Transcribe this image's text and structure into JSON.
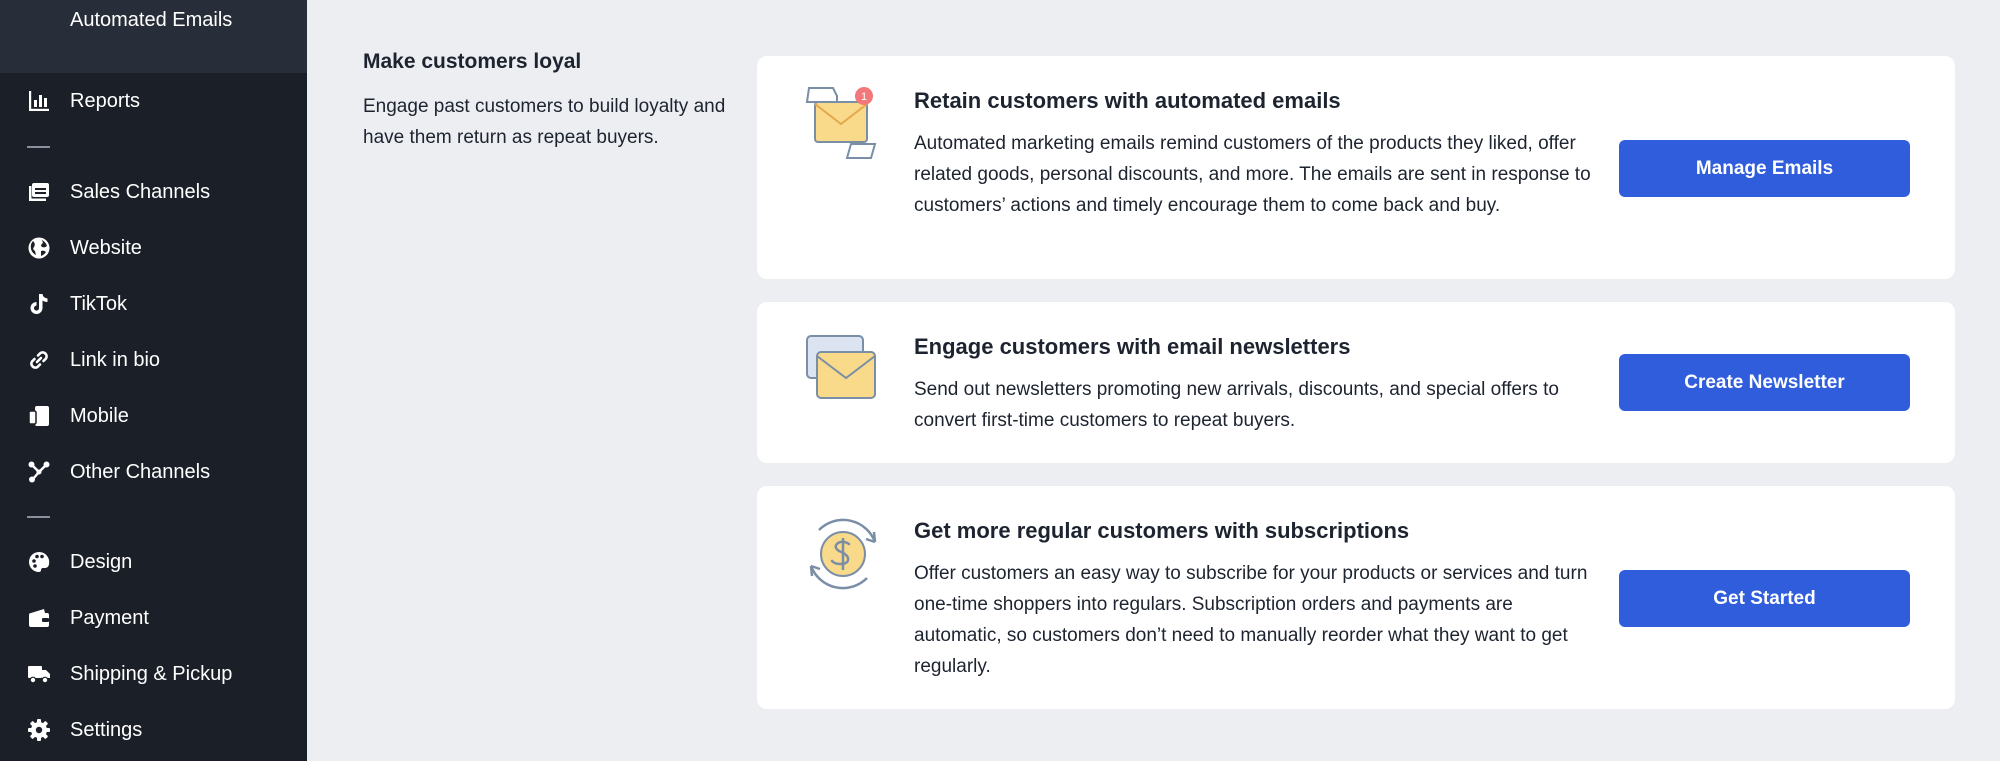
{
  "sidebar": {
    "sub_item": "Automated Emails",
    "items": [
      {
        "label": "Reports",
        "icon": "bar-chart-icon"
      },
      {
        "label": "Sales Channels",
        "icon": "sales-channels-icon"
      },
      {
        "label": "Website",
        "icon": "globe-icon"
      },
      {
        "label": "TikTok",
        "icon": "tiktok-icon"
      },
      {
        "label": "Link in bio",
        "icon": "link-icon"
      },
      {
        "label": "Mobile",
        "icon": "mobile-icon"
      },
      {
        "label": "Other Channels",
        "icon": "share-nodes-icon"
      },
      {
        "label": "Design",
        "icon": "palette-icon"
      },
      {
        "label": "Payment",
        "icon": "wallet-icon"
      },
      {
        "label": "Shipping & Pickup",
        "icon": "truck-icon"
      },
      {
        "label": "Settings",
        "icon": "gear-icon"
      }
    ]
  },
  "section": {
    "title": "Make customers loyal",
    "description": "Engage past customers to build loyalty and have them return as repeat buyers."
  },
  "cards": [
    {
      "title": "Retain customers with automated emails",
      "description": "Automated marketing emails remind customers of the products they liked, offer related goods, personal discounts, and more. The emails are sent in response to customers’ actions and timely encourage them to come back and buy.",
      "button": "Manage Emails",
      "icon": "automated-email-icon",
      "badge": "1"
    },
    {
      "title": "Engage customers with email newsletters",
      "description": "Send out newsletters promoting new arrivals, discounts, and special offers to convert first-time customers to repeat buyers.",
      "button": "Create Newsletter",
      "icon": "newsletter-icon"
    },
    {
      "title": "Get more regular customers with subscriptions",
      "description": "Offer customers an easy way to subscribe for your products or services and turn one-time shoppers into regulars. Subscription orders and payments are automatic, so customers don’t need to manually reorder what they want to get regularly.",
      "button": "Get Started",
      "icon": "subscription-dollar-icon"
    }
  ],
  "colors": {
    "sidebar_bg": "#1b1f27",
    "accent": "#2f5ddc",
    "page_bg": "#eceef1",
    "illustration_yellow": "#f9d98a",
    "illustration_stroke": "#7a8ea6",
    "badge_red": "#f2787a"
  }
}
